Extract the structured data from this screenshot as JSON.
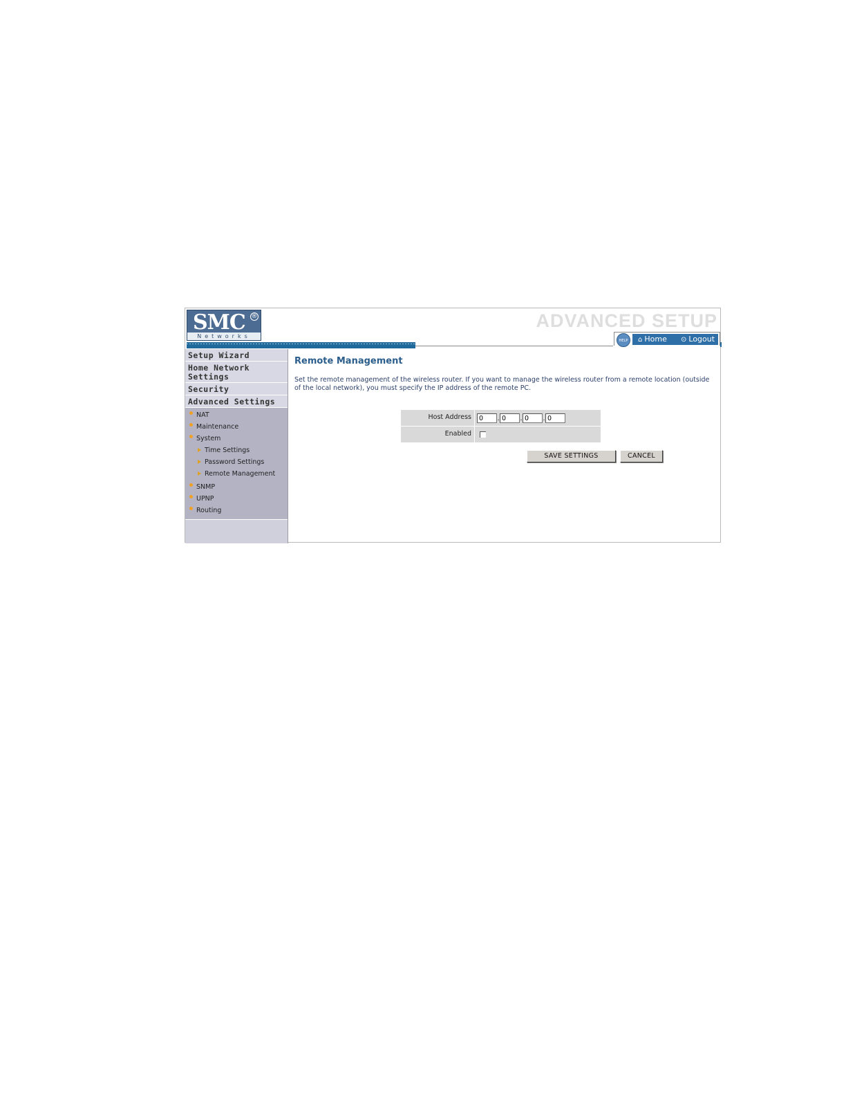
{
  "header": {
    "logo_brand": "SMC",
    "logo_registered": "®",
    "logo_sub": "Networks",
    "title": "ADVANCED SETUP",
    "help_label": "HELP",
    "home_label": "Home",
    "logout_label": "Logout"
  },
  "sidebar": {
    "top_items": [
      {
        "label": "Setup Wizard"
      },
      {
        "label": "Home Network Settings"
      },
      {
        "label": "Security"
      },
      {
        "label": "Advanced Settings"
      }
    ],
    "sub_items": [
      {
        "label": "NAT"
      },
      {
        "label": "Maintenance"
      },
      {
        "label": "System"
      },
      {
        "label": "Time Settings"
      },
      {
        "label": "Password Settings"
      },
      {
        "label": "Remote Management"
      },
      {
        "label": "SNMP"
      },
      {
        "label": "UPNP"
      },
      {
        "label": "Routing"
      }
    ]
  },
  "main": {
    "title": "Remote Management",
    "description": "Set the remote management of the wireless router. If you want to manage the wireless router from a remote location (outside of the local network), you must specify the IP address of the remote PC.",
    "host_address_label": "Host Address",
    "host_address": [
      "0",
      "0",
      "0",
      "0"
    ],
    "ip_separator": ".",
    "enabled_label": "Enabled",
    "enabled_checked": false,
    "save_button": "SAVE SETTINGS",
    "cancel_button": "CANCEL"
  },
  "colors": {
    "accent_blue": "#1f6a9a",
    "title_blue": "#2b5e8c",
    "sidebar_bg": "#cfd0db",
    "subnav_bg": "#b3b3c4",
    "bullet_orange": "#f0a024"
  }
}
